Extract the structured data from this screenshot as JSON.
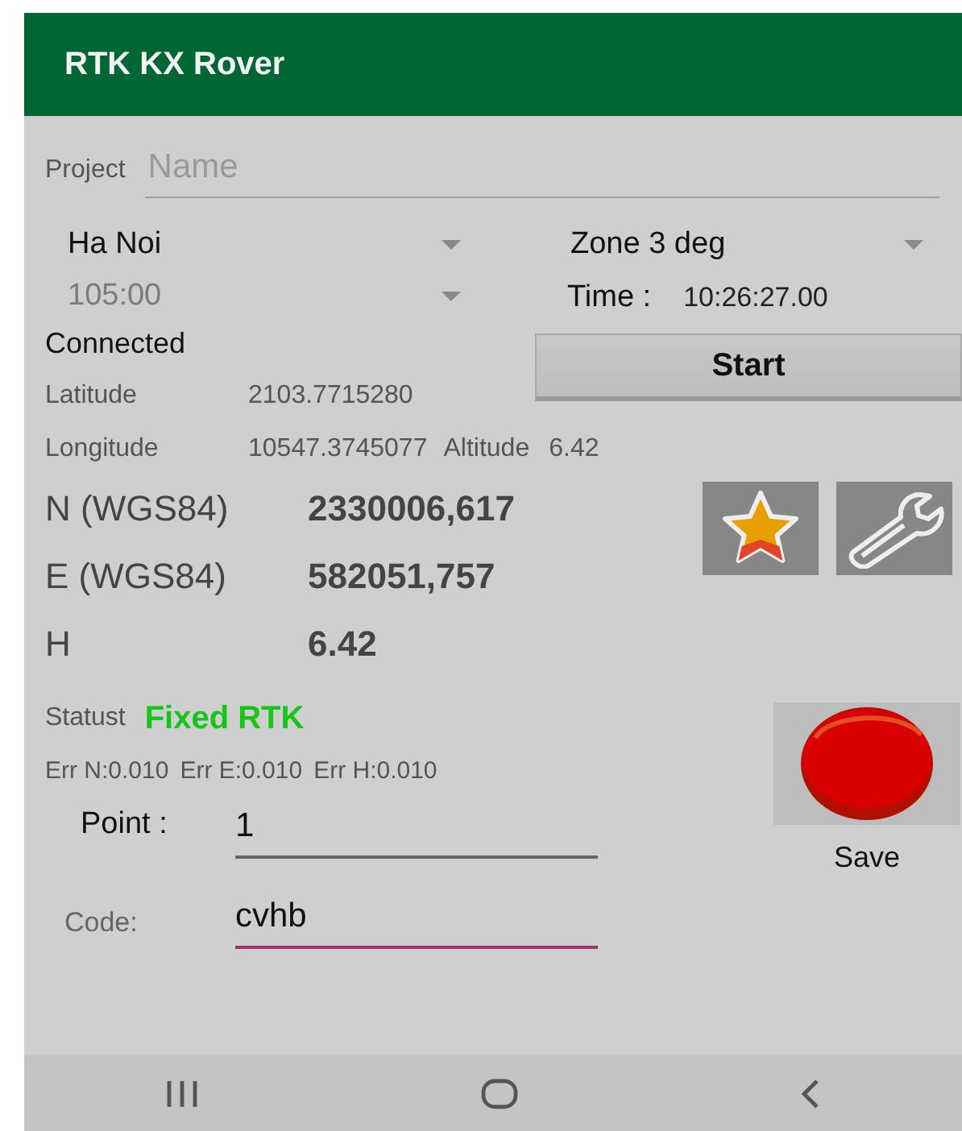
{
  "app_bar": {
    "title": "RTK KX Rover"
  },
  "project": {
    "label": "Project",
    "placeholder": "Name"
  },
  "dropdowns": [
    {
      "value": "Ha Noi",
      "disabled": false
    },
    {
      "value": "Zone 3 deg",
      "disabled": false
    },
    {
      "value": "105:00",
      "disabled": true
    }
  ],
  "time": {
    "label": "Time :",
    "value": "10:26:27.00"
  },
  "connection_status": "Connected",
  "start_button": "Start",
  "latitude": {
    "label": "Latitude",
    "value": "2103.7715280"
  },
  "longitude": {
    "label": "Longitude",
    "value": "10547.3745077"
  },
  "altitude": {
    "label": "Altitude",
    "value": "6.42"
  },
  "coordinates": [
    {
      "label": "N (WGS84)",
      "value": "2330006,617"
    },
    {
      "label": "E (WGS84)",
      "value": "582051,757"
    },
    {
      "label": "H",
      "value": "6.42"
    }
  ],
  "status": {
    "label": "Statust",
    "value": "Fixed RTK"
  },
  "errors": [
    "Err N:0.010",
    "Err E:0.010",
    "Err H:0.010"
  ],
  "point": {
    "label": "Point :",
    "value": "1",
    "focused": false
  },
  "code": {
    "label": "Code:",
    "value": "cvhb",
    "focused": true
  },
  "save_button": {
    "label": "Save"
  }
}
